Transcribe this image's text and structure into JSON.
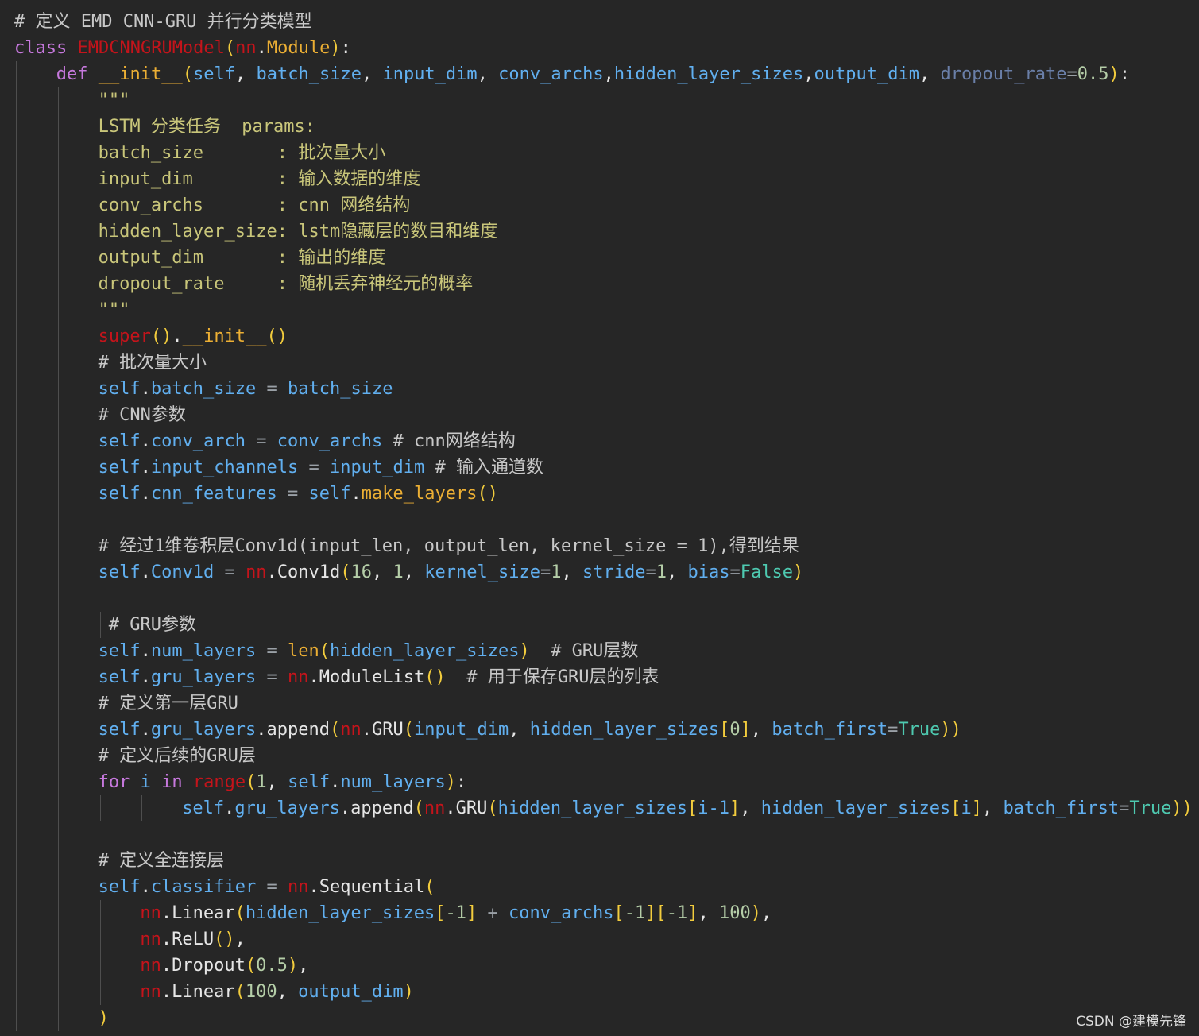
{
  "colors": {
    "background": "#262626",
    "default": "#e6e6e6",
    "comment": "#c8c8c8",
    "keyword": "#c678dd",
    "variable": "#61afef",
    "dimmed": "#6a7fa8",
    "string": "#c9c67a",
    "error": "#c4141b",
    "call": "#ecaf34",
    "bracket": "#f2cc3d",
    "number": "#b5cea8",
    "boolean": "#4ec9b0",
    "operator": "#9aa0a6",
    "guide": "#4e4e4e"
  },
  "editor": {
    "language": "python",
    "lines": [
      {
        "indent": 0,
        "tokens": [
          [
            "# 定义 EMD CNN-GRU 并行分类模型",
            "comment"
          ]
        ]
      },
      {
        "indent": 0,
        "tokens": [
          [
            "class",
            "keyword"
          ],
          [
            " ",
            "default"
          ],
          [
            "EMDCNNGRUModel",
            "error"
          ],
          [
            "(",
            "bracket"
          ],
          [
            "nn",
            "error"
          ],
          [
            ".",
            "default"
          ],
          [
            "Module",
            "call"
          ],
          [
            ")",
            "bracket"
          ],
          [
            ":",
            "default"
          ]
        ]
      },
      {
        "indent": 4,
        "tokens": [
          [
            "def",
            "keyword"
          ],
          [
            " ",
            "default"
          ],
          [
            "__init__",
            "call"
          ],
          [
            "(",
            "bracket"
          ],
          [
            "self",
            "variable"
          ],
          [
            ", ",
            "default"
          ],
          [
            "batch_size",
            "variable"
          ],
          [
            ", ",
            "default"
          ],
          [
            "input_dim",
            "variable"
          ],
          [
            ", ",
            "default"
          ],
          [
            "conv_archs",
            "variable"
          ],
          [
            ",",
            "default"
          ],
          [
            "hidden_layer_sizes",
            "variable"
          ],
          [
            ",",
            "default"
          ],
          [
            "output_dim",
            "variable"
          ],
          [
            ", ",
            "default"
          ],
          [
            "dropout_rate",
            "dimmed"
          ],
          [
            "=",
            "operator"
          ],
          [
            "0.5",
            "number"
          ],
          [
            ")",
            "bracket"
          ],
          [
            ":",
            "default"
          ]
        ]
      },
      {
        "indent": 8,
        "tokens": [
          [
            "\"\"\"",
            "string"
          ]
        ]
      },
      {
        "indent": 8,
        "tokens": [
          [
            "LSTM 分类任务  params:",
            "string"
          ]
        ]
      },
      {
        "indent": 8,
        "tokens": [
          [
            "batch_size       : 批次量大小",
            "string"
          ]
        ]
      },
      {
        "indent": 8,
        "tokens": [
          [
            "input_dim        : 输入数据的维度",
            "string"
          ]
        ]
      },
      {
        "indent": 8,
        "tokens": [
          [
            "conv_archs       : cnn 网络结构",
            "string"
          ]
        ]
      },
      {
        "indent": 8,
        "tokens": [
          [
            "hidden_layer_size: lstm隐藏层的数目和维度",
            "string"
          ]
        ]
      },
      {
        "indent": 8,
        "tokens": [
          [
            "output_dim       : 输出的维度",
            "string"
          ]
        ]
      },
      {
        "indent": 8,
        "tokens": [
          [
            "dropout_rate     : 随机丢弃神经元的概率",
            "string"
          ]
        ]
      },
      {
        "indent": 8,
        "tokens": [
          [
            "\"\"\"",
            "string"
          ]
        ]
      },
      {
        "indent": 8,
        "tokens": [
          [
            "super",
            "error"
          ],
          [
            "()",
            "bracket"
          ],
          [
            ".",
            "default"
          ],
          [
            "__init__",
            "call"
          ],
          [
            "()",
            "bracket"
          ]
        ]
      },
      {
        "indent": 8,
        "tokens": [
          [
            "# 批次量大小",
            "comment"
          ]
        ]
      },
      {
        "indent": 8,
        "tokens": [
          [
            "self",
            "variable"
          ],
          [
            ".",
            "default"
          ],
          [
            "batch_size",
            "variable"
          ],
          [
            " = ",
            "operator"
          ],
          [
            "batch_size",
            "variable"
          ]
        ]
      },
      {
        "indent": 8,
        "tokens": [
          [
            "# CNN参数",
            "comment"
          ]
        ]
      },
      {
        "indent": 8,
        "tokens": [
          [
            "self",
            "variable"
          ],
          [
            ".",
            "default"
          ],
          [
            "conv_arch",
            "variable"
          ],
          [
            " = ",
            "operator"
          ],
          [
            "conv_archs",
            "variable"
          ],
          [
            " # cnn网络结构",
            "comment"
          ]
        ]
      },
      {
        "indent": 8,
        "tokens": [
          [
            "self",
            "variable"
          ],
          [
            ".",
            "default"
          ],
          [
            "input_channels",
            "variable"
          ],
          [
            " = ",
            "operator"
          ],
          [
            "input_dim",
            "variable"
          ],
          [
            " # 输入通道数",
            "comment"
          ]
        ]
      },
      {
        "indent": 8,
        "tokens": [
          [
            "self",
            "variable"
          ],
          [
            ".",
            "default"
          ],
          [
            "cnn_features",
            "variable"
          ],
          [
            " = ",
            "operator"
          ],
          [
            "self",
            "variable"
          ],
          [
            ".",
            "default"
          ],
          [
            "make_layers",
            "call"
          ],
          [
            "()",
            "bracket"
          ]
        ]
      },
      {
        "indent": 0,
        "tokens": []
      },
      {
        "indent": 8,
        "tokens": [
          [
            "# 经过1维卷积层Conv1d(input_len, output_len, kernel_size = 1),得到结果",
            "comment"
          ]
        ]
      },
      {
        "indent": 8,
        "tokens": [
          [
            "self",
            "variable"
          ],
          [
            ".",
            "default"
          ],
          [
            "Conv1d",
            "variable"
          ],
          [
            " = ",
            "operator"
          ],
          [
            "nn",
            "error"
          ],
          [
            ".",
            "default"
          ],
          [
            "Conv1d",
            "default"
          ],
          [
            "(",
            "bracket"
          ],
          [
            "16",
            "number"
          ],
          [
            ", ",
            "default"
          ],
          [
            "1",
            "number"
          ],
          [
            ", ",
            "default"
          ],
          [
            "kernel_size",
            "variable"
          ],
          [
            "=",
            "operator"
          ],
          [
            "1",
            "number"
          ],
          [
            ", ",
            "default"
          ],
          [
            "stride",
            "variable"
          ],
          [
            "=",
            "operator"
          ],
          [
            "1",
            "number"
          ],
          [
            ", ",
            "default"
          ],
          [
            "bias",
            "variable"
          ],
          [
            "=",
            "operator"
          ],
          [
            "False",
            "boolean"
          ],
          [
            ")",
            "bracket"
          ]
        ]
      },
      {
        "indent": 0,
        "tokens": []
      },
      {
        "indent": 9,
        "tokens": [
          [
            "# GRU参数",
            "comment"
          ]
        ]
      },
      {
        "indent": 8,
        "tokens": [
          [
            "self",
            "variable"
          ],
          [
            ".",
            "default"
          ],
          [
            "num_layers",
            "variable"
          ],
          [
            " = ",
            "operator"
          ],
          [
            "len",
            "call"
          ],
          [
            "(",
            "bracket"
          ],
          [
            "hidden_layer_sizes",
            "variable"
          ],
          [
            ")",
            "bracket"
          ],
          [
            "  # GRU层数",
            "comment"
          ]
        ]
      },
      {
        "indent": 8,
        "tokens": [
          [
            "self",
            "variable"
          ],
          [
            ".",
            "default"
          ],
          [
            "gru_layers",
            "variable"
          ],
          [
            " = ",
            "operator"
          ],
          [
            "nn",
            "error"
          ],
          [
            ".",
            "default"
          ],
          [
            "ModuleList",
            "default"
          ],
          [
            "()",
            "bracket"
          ],
          [
            "  # 用于保存GRU层的列表",
            "comment"
          ]
        ]
      },
      {
        "indent": 8,
        "tokens": [
          [
            "# 定义第一层GRU",
            "comment"
          ]
        ]
      },
      {
        "indent": 8,
        "tokens": [
          [
            "self",
            "variable"
          ],
          [
            ".",
            "default"
          ],
          [
            "gru_layers",
            "variable"
          ],
          [
            ".",
            "default"
          ],
          [
            "append",
            "default"
          ],
          [
            "(",
            "bracket"
          ],
          [
            "nn",
            "error"
          ],
          [
            ".",
            "default"
          ],
          [
            "GRU",
            "default"
          ],
          [
            "(",
            "bracket"
          ],
          [
            "input_dim",
            "variable"
          ],
          [
            ", ",
            "default"
          ],
          [
            "hidden_layer_sizes",
            "variable"
          ],
          [
            "[",
            "bracket"
          ],
          [
            "0",
            "number"
          ],
          [
            "]",
            "bracket"
          ],
          [
            ", ",
            "default"
          ],
          [
            "batch_first",
            "variable"
          ],
          [
            "=",
            "operator"
          ],
          [
            "True",
            "boolean"
          ],
          [
            "))",
            "bracket"
          ]
        ]
      },
      {
        "indent": 8,
        "tokens": [
          [
            "# 定义后续的GRU层",
            "comment"
          ]
        ]
      },
      {
        "indent": 8,
        "tokens": [
          [
            "for",
            "keyword"
          ],
          [
            " ",
            "default"
          ],
          [
            "i",
            "variable"
          ],
          [
            " ",
            "default"
          ],
          [
            "in",
            "keyword"
          ],
          [
            " ",
            "default"
          ],
          [
            "range",
            "error"
          ],
          [
            "(",
            "bracket"
          ],
          [
            "1",
            "number"
          ],
          [
            ", ",
            "default"
          ],
          [
            "self",
            "variable"
          ],
          [
            ".",
            "default"
          ],
          [
            "num_layers",
            "variable"
          ],
          [
            ")",
            "bracket"
          ],
          [
            ":",
            "default"
          ]
        ]
      },
      {
        "indent": 16,
        "tokens": [
          [
            "self",
            "variable"
          ],
          [
            ".",
            "default"
          ],
          [
            "gru_layers",
            "variable"
          ],
          [
            ".",
            "default"
          ],
          [
            "append",
            "default"
          ],
          [
            "(",
            "bracket"
          ],
          [
            "nn",
            "error"
          ],
          [
            ".",
            "default"
          ],
          [
            "GRU",
            "default"
          ],
          [
            "(",
            "bracket"
          ],
          [
            "hidden_layer_sizes",
            "variable"
          ],
          [
            "[",
            "bracket"
          ],
          [
            "i-1",
            "variable"
          ],
          [
            "]",
            "bracket"
          ],
          [
            ", ",
            "default"
          ],
          [
            "hidden_layer_sizes",
            "variable"
          ],
          [
            "[",
            "bracket"
          ],
          [
            "i",
            "variable"
          ],
          [
            "]",
            "bracket"
          ],
          [
            ", ",
            "default"
          ],
          [
            "batch_first",
            "variable"
          ],
          [
            "=",
            "operator"
          ],
          [
            "True",
            "boolean"
          ],
          [
            "))",
            "bracket"
          ]
        ]
      },
      {
        "indent": 0,
        "tokens": []
      },
      {
        "indent": 8,
        "tokens": [
          [
            "# 定义全连接层",
            "comment"
          ]
        ]
      },
      {
        "indent": 8,
        "tokens": [
          [
            "self",
            "variable"
          ],
          [
            ".",
            "default"
          ],
          [
            "classifier",
            "variable"
          ],
          [
            " = ",
            "operator"
          ],
          [
            "nn",
            "error"
          ],
          [
            ".",
            "default"
          ],
          [
            "Sequential",
            "default"
          ],
          [
            "(",
            "bracket"
          ]
        ]
      },
      {
        "indent": 12,
        "tokens": [
          [
            "nn",
            "error"
          ],
          [
            ".",
            "default"
          ],
          [
            "Linear",
            "default"
          ],
          [
            "(",
            "bracket"
          ],
          [
            "hidden_layer_sizes",
            "variable"
          ],
          [
            "[",
            "bracket"
          ],
          [
            "-1",
            "number"
          ],
          [
            "]",
            "bracket"
          ],
          [
            " + ",
            "operator"
          ],
          [
            "conv_archs",
            "variable"
          ],
          [
            "[",
            "bracket"
          ],
          [
            "-1",
            "number"
          ],
          [
            "][",
            "bracket"
          ],
          [
            "-1",
            "number"
          ],
          [
            "]",
            "bracket"
          ],
          [
            ", ",
            "default"
          ],
          [
            "100",
            "number"
          ],
          [
            ")",
            "bracket"
          ],
          [
            ",",
            "default"
          ]
        ]
      },
      {
        "indent": 12,
        "tokens": [
          [
            "nn",
            "error"
          ],
          [
            ".",
            "default"
          ],
          [
            "ReLU",
            "default"
          ],
          [
            "()",
            "bracket"
          ],
          [
            ",",
            "default"
          ]
        ]
      },
      {
        "indent": 12,
        "tokens": [
          [
            "nn",
            "error"
          ],
          [
            ".",
            "default"
          ],
          [
            "Dropout",
            "default"
          ],
          [
            "(",
            "bracket"
          ],
          [
            "0.5",
            "number"
          ],
          [
            ")",
            "bracket"
          ],
          [
            ",",
            "default"
          ]
        ]
      },
      {
        "indent": 12,
        "tokens": [
          [
            "nn",
            "error"
          ],
          [
            ".",
            "default"
          ],
          [
            "Linear",
            "default"
          ],
          [
            "(",
            "bracket"
          ],
          [
            "100",
            "number"
          ],
          [
            ", ",
            "default"
          ],
          [
            "output_dim",
            "variable"
          ],
          [
            ")",
            "bracket"
          ]
        ]
      },
      {
        "indent": 8,
        "tokens": [
          [
            ")",
            "bracket"
          ]
        ]
      }
    ]
  },
  "watermark": "CSDN @建模先锋"
}
